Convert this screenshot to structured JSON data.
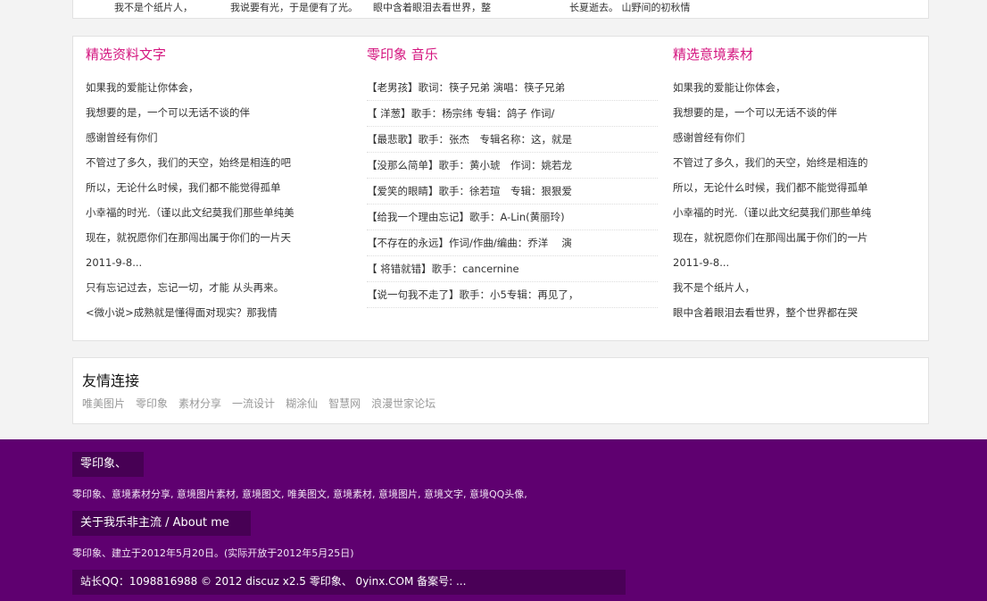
{
  "top_strip": [
    "我不是个纸片人，",
    "我说要有光，于是便有了光。",
    "眼中含着眼泪去看世界，整",
    "长夏逝去。 山野间的初秋情"
  ],
  "columns": [
    {
      "title": "精选资料文字",
      "items": [
        "如果我的爱能让你体会，",
        "我想要的是，一个可以无话不谈的伴",
        "感谢曾经有你们",
        "不管过了多久，我们的天空，始终是相连的吧",
        "所以，无论什么时候，我们都不能觉得孤单",
        "小幸福的时光.（谨以此文纪莫我们那些单纯美",
        "现在，就祝愿你们在那闯出属于你们的一片天",
        "2011-9-8...",
        "只有忘记过去，忘记一切，才能 从头再来。",
        "<微小说>成熟就是懂得面对现实？那我情"
      ]
    },
    {
      "title": "零印象 音乐",
      "items": [
        "【老男孩】歌词：筷子兄弟 演唱：筷子兄弟",
        "【 洋葱】歌手：杨宗纬 专辑：鸽子 作词/",
        "【最悲歌】歌手：张杰　专辑名称：这，就是",
        "【没那么简单】歌手：黄小琥　作词：姚若龙",
        "【爱笑的眼睛】歌手：徐若瑄　专辑：狠狠爱",
        "【给我一个理由忘记】歌手：A-Lin(黄丽玲)",
        "【不存在的永远】作词/作曲/编曲：乔洋　 演",
        "【 将错就错】歌手：cancernine",
        "【说一句我不走了】歌手：小5专辑：再见了，"
      ]
    },
    {
      "title": "精选意境素材",
      "items": [
        "如果我的爱能让你体会，",
        "我想要的是，一个可以无话不谈的伴",
        "感谢曾经有你们",
        "不管过了多久，我们的天空，始终是相连的",
        "所以，无论什么时候，我们都不能觉得孤单",
        "小幸福的时光.（谨以此文纪莫我们那些单纯",
        "现在，就祝愿你们在那闯出属于你们的一片",
        "2011-9-8...",
        "我不是个纸片人，",
        "眼中含着眼泪去看世界，整个世界都在哭"
      ]
    }
  ],
  "friends": {
    "title": "友情连接",
    "links": [
      "唯美图片",
      "零印象",
      "素材分享",
      "一流设计",
      "糊涂仙",
      "智慧网",
      "浪漫世家论坛"
    ]
  },
  "footer": {
    "box1": "零印象、",
    "tags": "零印象、意境素材分享, 意境图片素材, 意境图文, 唯美图文, 意境素材, 意境图片, 意境文字, 意境QQ头像,",
    "box2": "关于我乐非主流 / About me",
    "about": "零印象、建立于2012年5月20日。(实际开放于2012年5月25日)",
    "copyright": "站长QQ：1098816988 © 2012 discuz x2.5 零印象、 0yinx.COM 备案号: ..."
  }
}
